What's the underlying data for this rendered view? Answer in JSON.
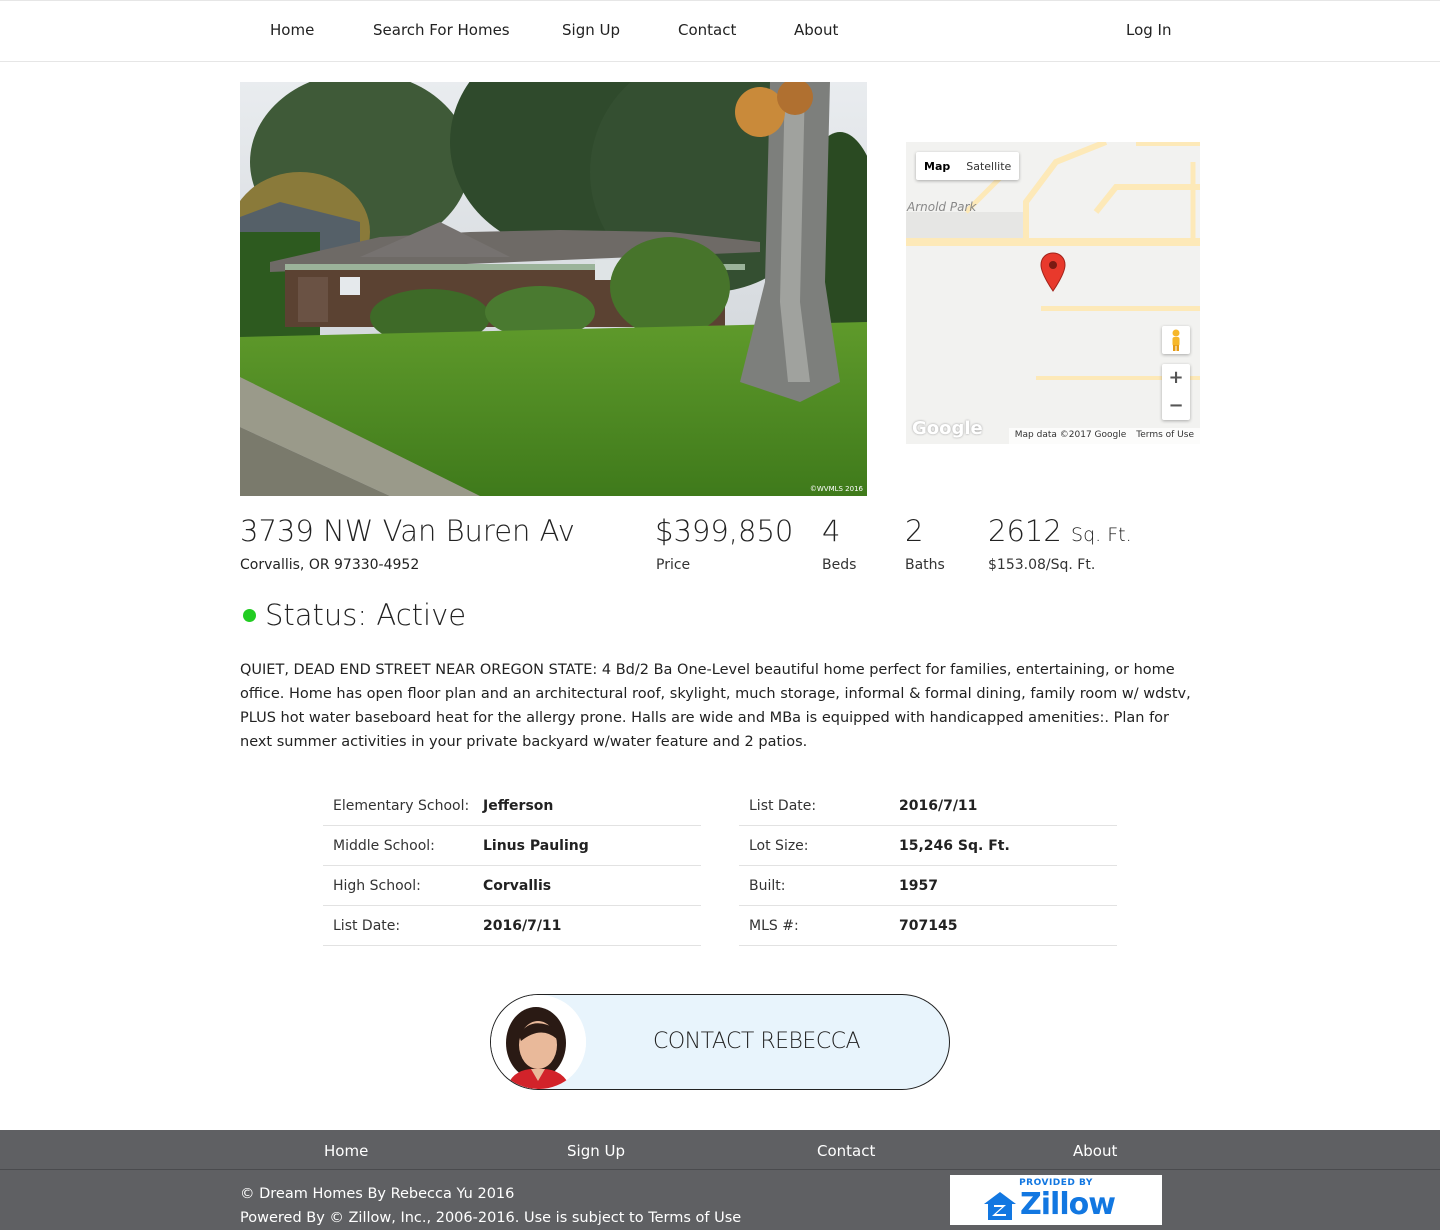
{
  "nav": {
    "home": "Home",
    "search": "Search For Homes",
    "signup": "Sign Up",
    "contact": "Contact",
    "about": "About",
    "login": "Log In"
  },
  "photo": {
    "watermark": "©WVMLS 2016"
  },
  "map": {
    "map_tab": "Map",
    "satellite_tab": "Satellite",
    "park_label": "Arnold Park",
    "zoom_in": "+",
    "zoom_out": "−",
    "google_logo": "Google",
    "map_data": "Map data ©2017 Google",
    "terms": "Terms of Use"
  },
  "property": {
    "address": "3739 NW Van Buren Av",
    "city": "Corvallis, OR 97330-4952",
    "price": "$399,850",
    "price_label": "Price",
    "beds": "4",
    "beds_label": "Beds",
    "baths": "2",
    "baths_label": "Baths",
    "sqft": "2612",
    "sqft_unit": "Sq. Ft.",
    "price_per_sqft": "$153.08/Sq. Ft.",
    "status": "Status: Active",
    "status_color": "#22cc22",
    "description": "QUIET, DEAD END STREET NEAR OREGON STATE: 4 Bd/2 Ba One-Level beautiful home perfect for families, entertaining, or home office. Home has open floor plan and an architectural roof, skylight, much storage, informal & formal dining, family room w/ wdstv, PLUS hot water baseboard heat for the allergy prone. Halls are wide and MBa is equipped with handicapped amenities:. Plan for next summer activities in your private backyard w/water feature and 2 patios."
  },
  "details_left": [
    {
      "label": "Elementary School:",
      "value": "Jefferson"
    },
    {
      "label": "Middle School:",
      "value": "Linus Pauling"
    },
    {
      "label": "High School:",
      "value": "Corvallis"
    },
    {
      "label": "List Date:",
      "value": "2016/7/11"
    }
  ],
  "details_right": [
    {
      "label": "List Date:",
      "value": "2016/7/11"
    },
    {
      "label": "Lot Size:",
      "value": "15,246 Sq. Ft."
    },
    {
      "label": "Built:",
      "value": "1957"
    },
    {
      "label": "MLS #:",
      "value": "707145"
    }
  ],
  "contact_button": {
    "label": "CONTACT REBECCA"
  },
  "footer": {
    "home": "Home",
    "signup": "Sign Up",
    "contact": "Contact",
    "about": "About",
    "copyright": "© Dream Homes By Rebecca Yu 2016",
    "powered": "Powered By © Zillow, Inc., 2006-2016. Use is subject to Terms of Use",
    "zillow_provided": "PROVIDED BY",
    "zillow_name": "Zillow",
    "zillow_color": "#1277e1"
  }
}
